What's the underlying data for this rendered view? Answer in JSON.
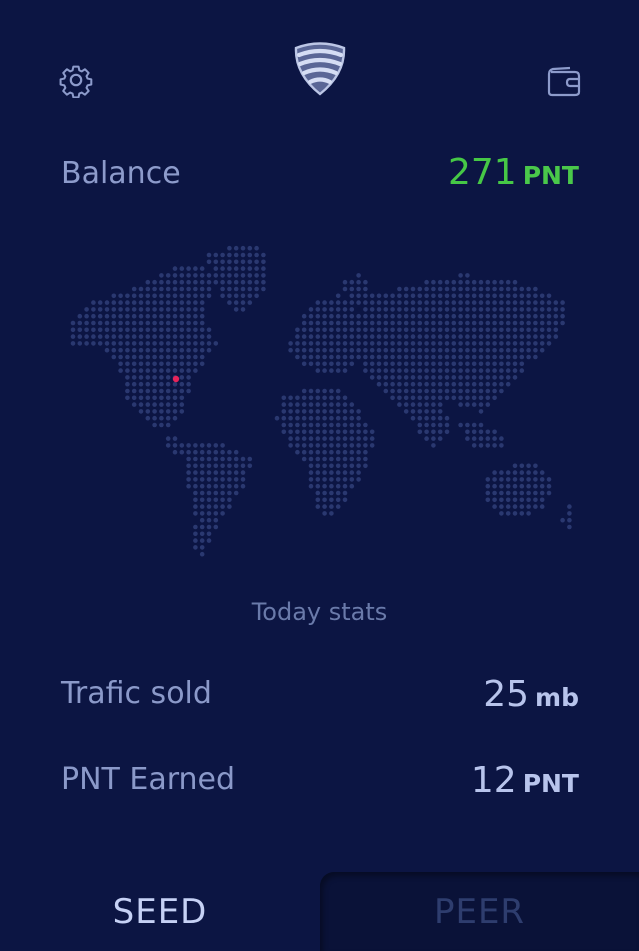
{
  "header": {
    "settings_icon": "gear-icon",
    "logo_icon": "shield-logo-icon",
    "wallet_icon": "wallet-icon"
  },
  "balance": {
    "label": "Balance",
    "amount": "271",
    "unit": "PNT",
    "color": "#46c846"
  },
  "map": {
    "dot_color": "#2a3870",
    "marker_color": "#e6245a"
  },
  "stats": {
    "heading": "Today stats",
    "traffic": {
      "label": "Trafic sold",
      "value": "25",
      "unit": "mb"
    },
    "earned": {
      "label": "PNT Earned",
      "value": "12",
      "unit": "PNT"
    }
  },
  "tabs": {
    "seed": "SEED",
    "peer": "PEER"
  }
}
